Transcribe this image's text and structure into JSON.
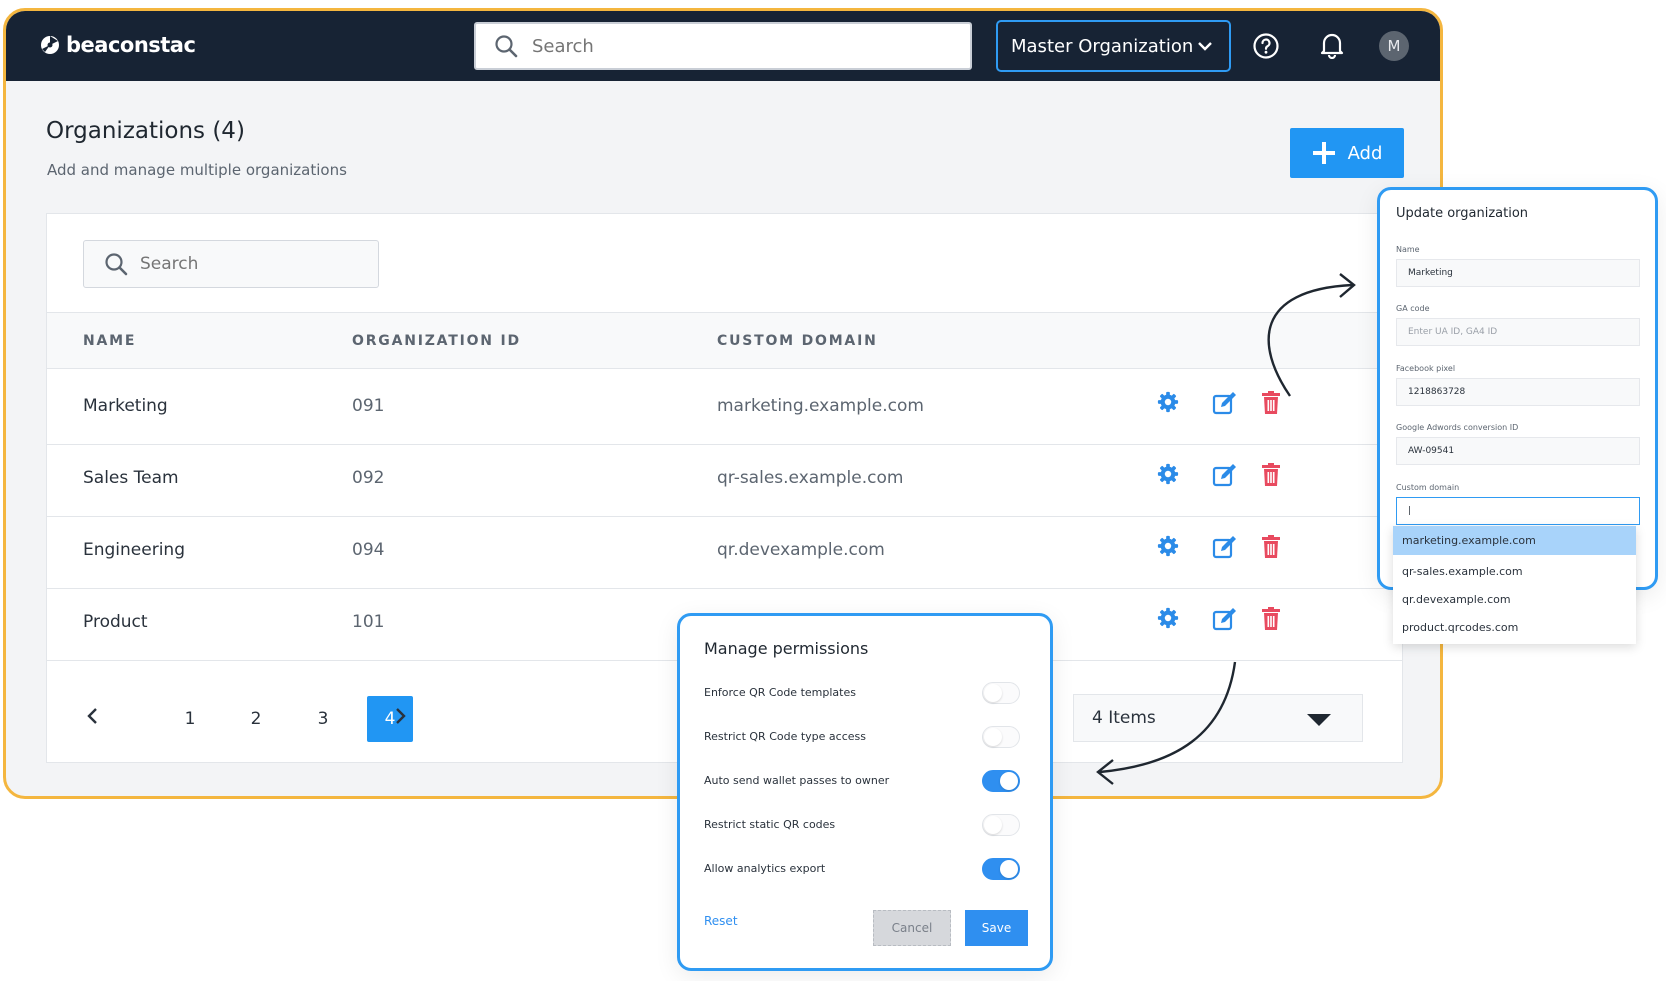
{
  "header": {
    "logo_text": "beaconstac",
    "search_placeholder": "Search",
    "org_selector": "Master Organization",
    "avatar_initial": "M"
  },
  "page": {
    "title": "Organizations (4)",
    "subtitle": "Add and manage multiple organizations",
    "add_label": "Add"
  },
  "table": {
    "search_placeholder": "Search",
    "columns": [
      "NAME",
      "ORGANIZATION ID",
      "CUSTOM DOMAIN"
    ],
    "rows": [
      {
        "name": "Marketing",
        "id": "091",
        "domain": "marketing.example.com"
      },
      {
        "name": "Sales Team",
        "id": "092",
        "domain": "qr-sales.example.com"
      },
      {
        "name": "Engineering",
        "id": "094",
        "domain": "qr.devexample.com"
      },
      {
        "name": "Product",
        "id": "101",
        "domain": ""
      }
    ]
  },
  "pagination": {
    "pages": [
      "1",
      "2",
      "3",
      "4"
    ],
    "active_page": "4",
    "items_label": "4 Items"
  },
  "update_org": {
    "title": "Update organization",
    "fields": [
      {
        "label": "Name",
        "value": "Marketing",
        "placeholder": ""
      },
      {
        "label": "GA code",
        "value": "",
        "placeholder": "Enter UA ID, GA4 ID"
      },
      {
        "label": "Facebook pixel",
        "value": "1218863728",
        "placeholder": ""
      },
      {
        "label": "Google Adwords conversion ID",
        "value": "AW-09541",
        "placeholder": ""
      },
      {
        "label": "Custom domain",
        "value": "|",
        "placeholder": ""
      }
    ],
    "domain_options": [
      "marketing.example.com",
      "qr-sales.example.com",
      "qr.devexample.com",
      "product.qrcodes.com"
    ],
    "selected_option": "marketing.example.com"
  },
  "permissions": {
    "title": "Manage permissions",
    "items": [
      {
        "label": "Enforce QR Code templates",
        "enabled": false
      },
      {
        "label": "Restrict QR Code type access",
        "enabled": false
      },
      {
        "label": "Auto send wallet passes to owner",
        "enabled": true
      },
      {
        "label": "Restrict static QR codes",
        "enabled": false
      },
      {
        "label": "Allow analytics export",
        "enabled": true
      }
    ],
    "reset_label": "Reset",
    "cancel_label": "Cancel",
    "save_label": "Save"
  },
  "colors": {
    "accent": "#2196f3",
    "topbar": "#172334",
    "frame": "#f4b63f",
    "delete": "#e84a5f"
  },
  "icons": {
    "settings": "gear-icon",
    "edit": "edit-icon",
    "delete": "trash-icon"
  }
}
